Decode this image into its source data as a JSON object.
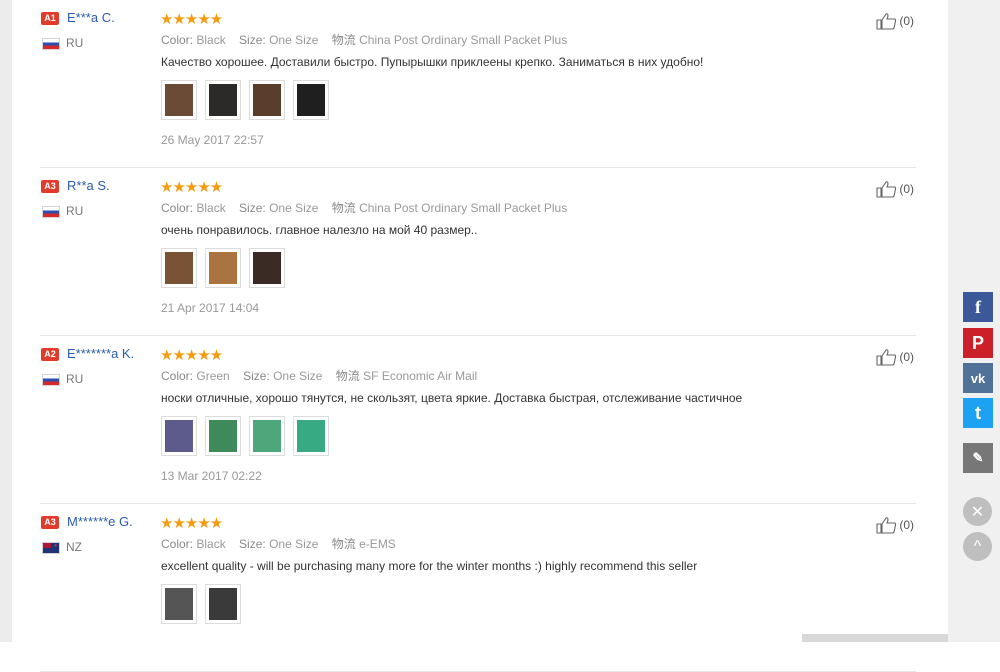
{
  "reviews": [
    {
      "badge": "A1",
      "name": "E***a C.",
      "country": "RU",
      "flag": "ru",
      "stars": "★★★★★",
      "color_label": "Color:",
      "color": "Black",
      "size_label": "Size:",
      "size": "One Size",
      "shipping_label": "物流",
      "shipping": "China Post Ordinary Small Packet Plus",
      "text": "Качество хорошее. Доставили быстро. Пупырышки приклеены крепко. Заниматься в них удобно!",
      "date": "26 May 2017 22:57",
      "helpful": "(0)",
      "images": [
        "#6b4b35",
        "#2c2a28",
        "#5a3d2a",
        "#1f1f1f"
      ]
    },
    {
      "badge": "A3",
      "name": "R**a S.",
      "country": "RU",
      "flag": "ru",
      "stars": "★★★★★",
      "color_label": "Color:",
      "color": "Black",
      "size_label": "Size:",
      "size": "One Size",
      "shipping_label": "物流",
      "shipping": "China Post Ordinary Small Packet Plus",
      "text": "очень понравилось. главное налезло на мой 40 размер..",
      "date": "21 Apr 2017 14:04",
      "helpful": "(0)",
      "images": [
        "#7a5236",
        "#a9743f",
        "#3a2c24"
      ]
    },
    {
      "badge": "A2",
      "name": "E*******a K.",
      "country": "RU",
      "flag": "ru",
      "stars": "★★★★★",
      "color_label": "Color:",
      "color": "Green",
      "size_label": "Size:",
      "size": "One Size",
      "shipping_label": "物流",
      "shipping": "SF Economic Air Mail",
      "text": "носки отличные, хорошо тянутся, не скользят, цвета яркие. Доставка быстрая, отслеживание частичное",
      "date": "13 Mar 2017 02:22",
      "helpful": "(0)",
      "images": [
        "#5d5a8c",
        "#3f8a5a",
        "#4da77a",
        "#37a983"
      ]
    },
    {
      "badge": "A3",
      "name": "M******e G.",
      "country": "NZ",
      "flag": "nz",
      "stars": "★★★★★",
      "color_label": "Color:",
      "color": "Black",
      "size_label": "Size:",
      "size": "One Size",
      "shipping_label": "物流",
      "shipping": "e-EMS",
      "text": "excellent quality - will be purchasing many more for the winter months :) highly recommend this seller",
      "date": "",
      "helpful": "(0)",
      "images": [
        "#555555",
        "#3a3a3a"
      ]
    }
  ],
  "share": {
    "facebook": "f",
    "pinterest": "P",
    "vk": "vk",
    "twitter": "t",
    "edit": "✎",
    "close": "✕",
    "up": "^"
  },
  "colors": {
    "accent_star": "#f39c12",
    "name_link": "#2a5ca8",
    "badge": "#e03b2b"
  }
}
